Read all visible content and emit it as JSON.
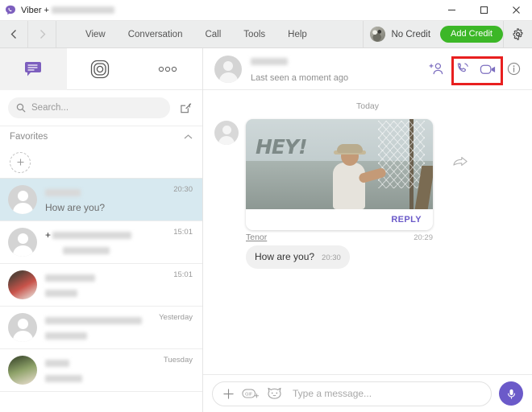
{
  "window": {
    "app_name": "Viber",
    "title_prefix": "Viber +",
    "title_number_redacted": true,
    "controls": {
      "minimize": "minimize-icon",
      "maximize": "maximize-icon",
      "close": "close-icon"
    }
  },
  "menubar": {
    "back": "back-arrow-icon",
    "forward": "forward-arrow-icon",
    "items": [
      {
        "label": "View"
      },
      {
        "label": "Conversation"
      },
      {
        "label": "Call"
      },
      {
        "label": "Tools"
      },
      {
        "label": "Help"
      }
    ],
    "credit_status": "No Credit",
    "add_credit_label": "Add Credit",
    "add_credit_color": "#3cb727",
    "settings_icon": "gear-icon"
  },
  "sidebar": {
    "tabs": [
      {
        "name": "chats",
        "icon": "chat-bubble-icon",
        "active": true
      },
      {
        "name": "explore",
        "icon": "explore-circle-icon",
        "active": false
      },
      {
        "name": "more",
        "icon": "more-dots-icon",
        "active": false
      }
    ],
    "search": {
      "placeholder": "Search...",
      "icon": "search-icon"
    },
    "compose_icon": "compose-icon",
    "favorites": {
      "title": "Favorites",
      "collapse_icon": "chevron-up-icon",
      "add_icon": "plus-icon"
    },
    "chats": [
      {
        "name_redacted": true,
        "preview": "How are you?",
        "time": "20:30",
        "active": true,
        "avatar": "placeholder",
        "prefix": ""
      },
      {
        "name_redacted": true,
        "preview": "",
        "time": "15:01",
        "active": false,
        "avatar": "placeholder",
        "prefix": "+"
      },
      {
        "name_redacted": true,
        "preview": "",
        "time": "15:01",
        "active": false,
        "avatar": "photo1",
        "prefix": ""
      },
      {
        "name_redacted": true,
        "preview": "",
        "time": "Yesterday",
        "active": false,
        "avatar": "placeholder",
        "prefix": ""
      },
      {
        "name_redacted": true,
        "preview": "",
        "time": "Tuesday",
        "active": false,
        "avatar": "photo2",
        "prefix": ""
      }
    ]
  },
  "conversation": {
    "contact_name_redacted": true,
    "status": "Last seen a moment ago",
    "actions": [
      {
        "name": "add-participant",
        "icon": "add-person-icon",
        "highlighted": false
      },
      {
        "name": "audio-call",
        "icon": "phone-icon",
        "highlighted": true
      },
      {
        "name": "video-call",
        "icon": "video-camera-icon",
        "highlighted": true
      },
      {
        "name": "info",
        "icon": "info-icon",
        "highlighted": false
      }
    ],
    "highlight_color": "#e81f1f",
    "day_separator": "Today",
    "messages": [
      {
        "type": "gif",
        "caption": "HEY!",
        "reply_label": "REPLY",
        "source": "Tenor",
        "time": "20:29",
        "forward_icon": "forward-arrow-icon"
      },
      {
        "type": "text",
        "text": "How are you?",
        "time": "20:30"
      }
    ],
    "composer": {
      "plus_icon": "plus-icon",
      "gif_icon": "gif-icon",
      "sticker_icon": "sticker-cat-icon",
      "placeholder": "Type a message...",
      "mic_icon": "microphone-icon",
      "mic_color": "#6b5ac9"
    }
  }
}
